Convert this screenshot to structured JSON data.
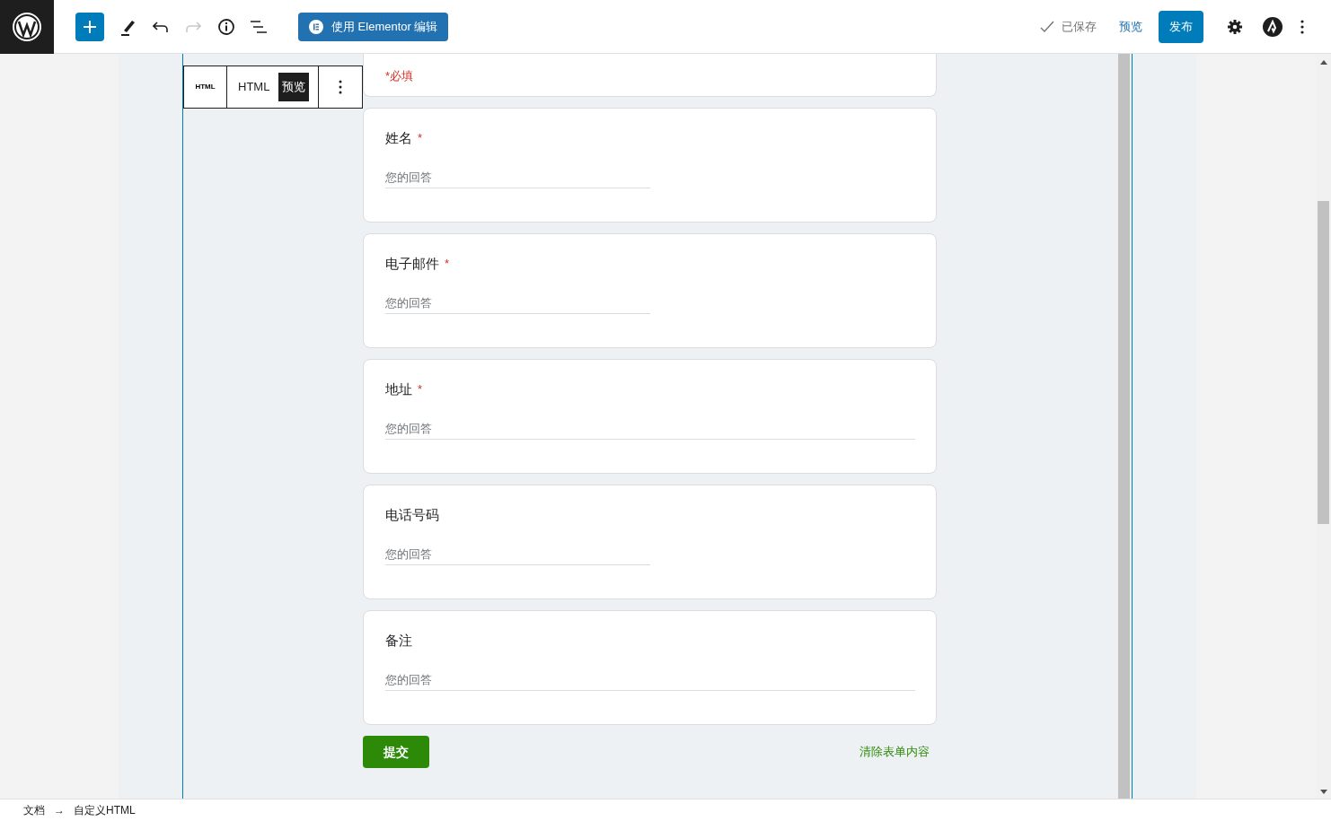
{
  "toolbar": {
    "elementor_button": "使用 Elementor 编辑",
    "saved": "已保存",
    "preview": "预览",
    "publish": "发布",
    "redo_disabled": true
  },
  "block_toolbar": {
    "type_label": "HTML",
    "html_tab": {
      "label": "HTML",
      "selected": false
    },
    "preview_tab": {
      "label": "预览",
      "selected": true
    }
  },
  "form": {
    "required_note": "*必填",
    "fields": [
      {
        "label": "姓名",
        "required_mark": "*",
        "placeholder": "您的回答",
        "wide": false
      },
      {
        "label": "电子邮件",
        "required_mark": "*",
        "placeholder": "您的回答",
        "wide": false
      },
      {
        "label": "地址",
        "required_mark": "*",
        "placeholder": "您的回答",
        "wide": true
      },
      {
        "label": "电话号码",
        "placeholder": "您的回答",
        "wide": false
      },
      {
        "label": "备注",
        "placeholder": "您的回答",
        "wide": true
      }
    ],
    "submit": "提交",
    "clear": "清除表单内容"
  },
  "breadcrumb": [
    "文档",
    "自定义HTML"
  ],
  "breadcrumb_separator": "→"
}
